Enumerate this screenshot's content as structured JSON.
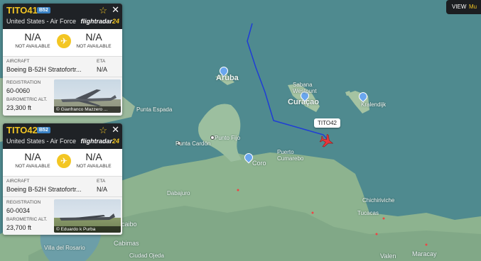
{
  "map": {
    "labels": {
      "aruba": "Aruba",
      "curacao": "Curaçao",
      "sabana_westpunt": "Sabana\nWestpunt",
      "kralendijk": "Kralendijk",
      "punta_espada": "Punta Espada",
      "punto_fijo": "Punto Fijo",
      "punta_cardon": "Punta Cardón",
      "coro": "Coro",
      "puerto_cumarebo": "Puerto\nCumarebo",
      "dabajuro": "Dabajuro",
      "chichiriviche": "Chichiriviche",
      "tucacas": "Tucacas",
      "cabimas": "Cabimas",
      "maracaibo": "caibo",
      "villa_del_rosario": "Villa del Rosario",
      "ciudad_ojeda": "Ciudad Ojeda",
      "maracay": "Maracay",
      "valencia": "Valen"
    },
    "tooltip": "TITO42",
    "view_button": {
      "label": "VIEW",
      "accent": "Mu"
    }
  },
  "cards": [
    {
      "callsign": "TITO41",
      "type_badge": "B52",
      "operator": "United States - Air Force",
      "brand": "flightradar",
      "brand_suffix": "24",
      "origin": {
        "code": "N/A",
        "status": "NOT AVAILABLE"
      },
      "destination": {
        "code": "N/A",
        "status": "NOT AVAILABLE"
      },
      "aircraft_label": "AIRCRAFT",
      "aircraft_value": "Boeing B-52H Stratofortr...",
      "eta_label": "ETA",
      "eta_value": "N/A",
      "registration_label": "REGISTRATION",
      "registration_value": "60-0060",
      "alt_label": "BAROMETRIC ALT.",
      "alt_value": "23,300 ft",
      "photo_credit": "© Gianfranco Mazzero ..."
    },
    {
      "callsign": "TITO42",
      "type_badge": "B52",
      "operator": "United States - Air Force",
      "brand": "flightradar",
      "brand_suffix": "24",
      "origin": {
        "code": "N/A",
        "status": "NOT AVAILABLE"
      },
      "destination": {
        "code": "N/A",
        "status": "NOT AVAILABLE"
      },
      "aircraft_label": "AIRCRAFT",
      "aircraft_value": "Boeing B-52H Stratofortr...",
      "eta_label": "ETA",
      "eta_value": "N/A",
      "registration_label": "REGISTRATION",
      "registration_value": "60-0034",
      "alt_label": "BAROMETRIC ALT.",
      "alt_value": "23,700 ft",
      "photo_credit": "© Eduardo k Purba"
    }
  ],
  "colors": {
    "sea": "#4f8a8f",
    "land": "#8fb59a",
    "track": "#1f3dd6",
    "plane": "#e8363b",
    "callsign": "#f3c623"
  }
}
